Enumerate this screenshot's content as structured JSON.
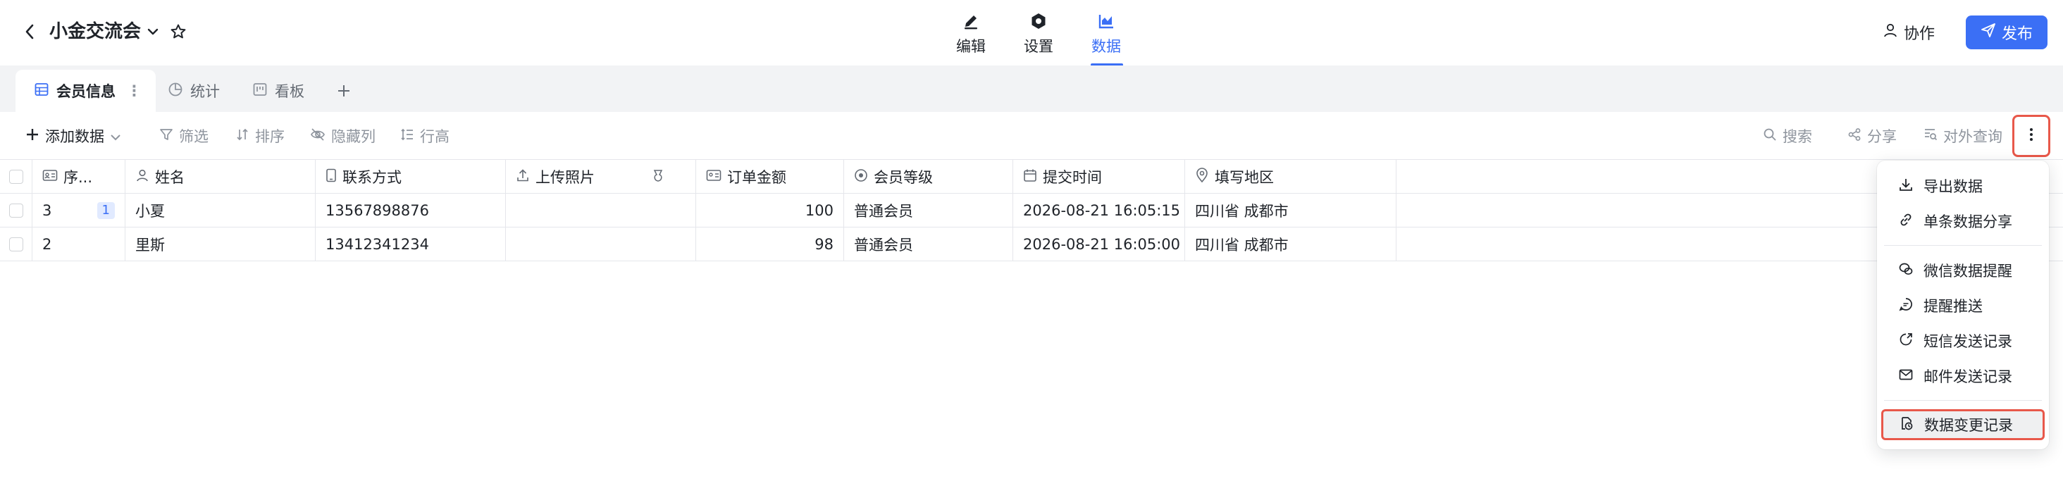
{
  "header": {
    "title": "小金交流会",
    "tabs": [
      {
        "label": "编辑",
        "icon": "pen-icon"
      },
      {
        "label": "设置",
        "icon": "settings-icon"
      },
      {
        "label": "数据",
        "icon": "chart-icon",
        "active": true
      }
    ],
    "collab_label": "协作",
    "publish_label": "发布"
  },
  "sheet_tabs": [
    {
      "label": "会员信息",
      "active": true,
      "icon": "table-icon"
    },
    {
      "label": "统计",
      "icon": "pie-chart-icon"
    },
    {
      "label": "看板",
      "icon": "kanban-icon"
    }
  ],
  "toolbar": {
    "add_data": "添加数据",
    "filter": "筛选",
    "sort": "排序",
    "hide_columns": "隐藏列",
    "row_height": "行高",
    "search": "搜索",
    "share": "分享",
    "public_query": "对外查询"
  },
  "table": {
    "columns": [
      {
        "label": "序...",
        "icon": "id-card-icon"
      },
      {
        "label": "姓名",
        "icon": "person-icon"
      },
      {
        "label": "联系方式",
        "icon": "phone-icon"
      },
      {
        "label": "上传照片",
        "icon": "upload-icon"
      },
      {
        "label": "",
        "icon": "image-field-icon"
      },
      {
        "label": "订单金额",
        "icon": "number-icon"
      },
      {
        "label": "会员等级",
        "icon": "radio-icon"
      },
      {
        "label": "提交时间",
        "icon": "calendar-icon"
      },
      {
        "label": "填写地区",
        "icon": "location-icon"
      }
    ],
    "rows": [
      {
        "seq": "3",
        "badge": "1",
        "name": "小夏",
        "phone": "13567898876",
        "amount": "100",
        "level": "普通会员",
        "time": "2026-08-21 16:05:15",
        "region": "四川省 成都市"
      },
      {
        "seq": "2",
        "badge": "",
        "name": "里斯",
        "phone": "13412341234",
        "amount": "98",
        "level": "普通会员",
        "time": "2026-08-21 16:05:00",
        "region": "四川省 成都市"
      }
    ]
  },
  "menu": {
    "items": [
      {
        "label": "导出数据",
        "icon": "download-icon"
      },
      {
        "label": "单条数据分享",
        "icon": "link-icon"
      },
      {
        "label": "微信数据提醒",
        "icon": "wechat-icon"
      },
      {
        "label": "提醒推送",
        "icon": "message-icon"
      },
      {
        "label": "短信发送记录",
        "icon": "sms-icon"
      },
      {
        "label": "邮件发送记录",
        "icon": "mail-icon"
      },
      {
        "label": "数据变更记录",
        "icon": "history-icon",
        "highlighted": true
      }
    ]
  },
  "colors": {
    "accent": "#3b6ff5",
    "highlight_border": "#e8584a",
    "muted_text": "#8f959e",
    "tabbar_bg": "#f2f3f5"
  }
}
